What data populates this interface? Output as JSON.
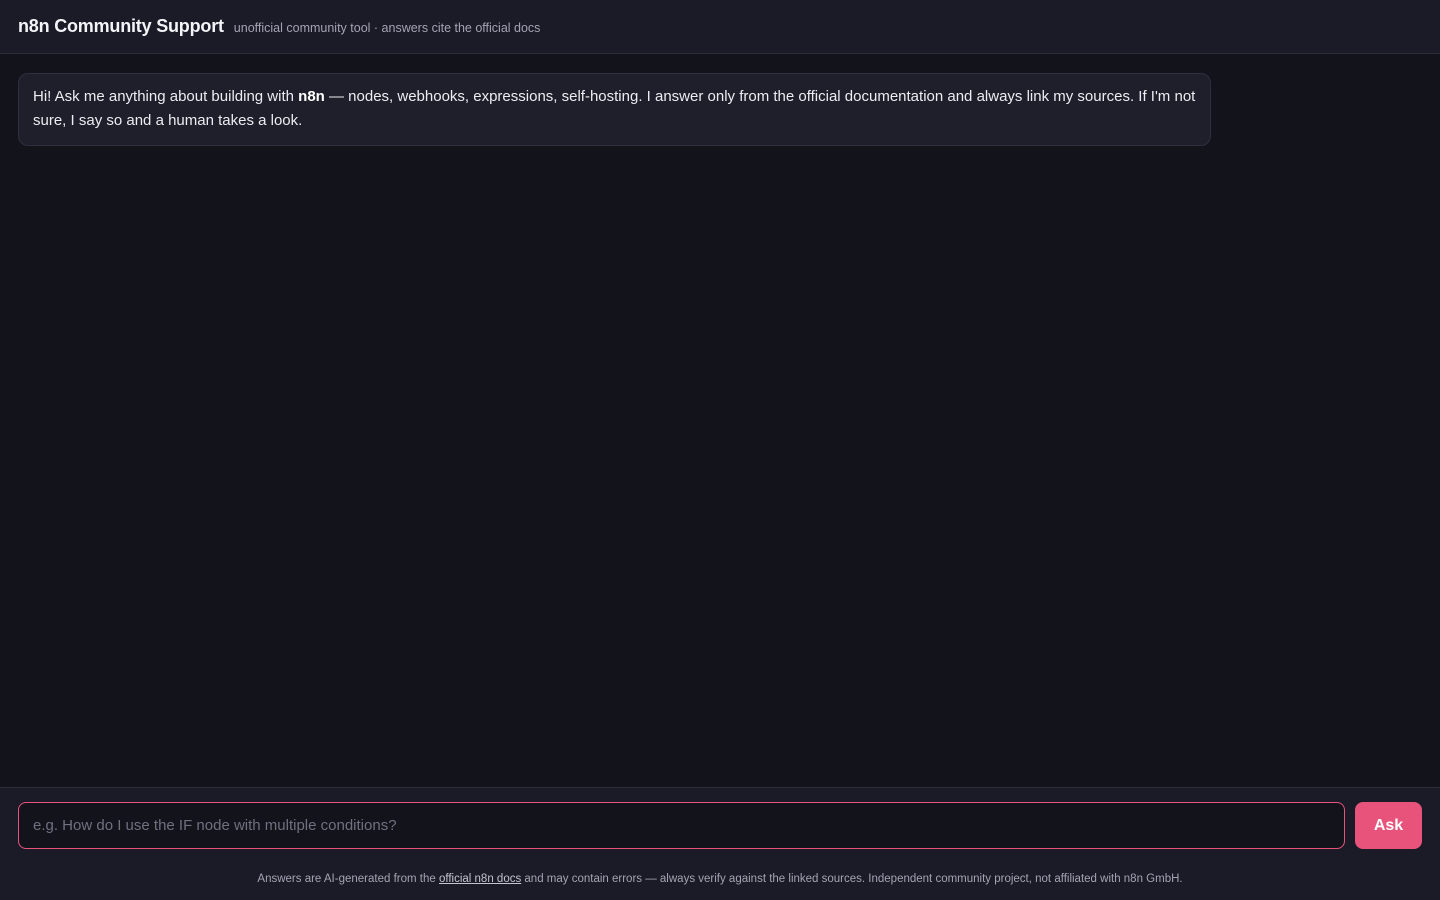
{
  "header": {
    "title": "n8n Community Support",
    "subtitle": "unofficial community tool · answers cite the official docs"
  },
  "messages": [
    {
      "role": "assistant",
      "text_before": "Hi! Ask me anything about building with ",
      "text_bold": "n8n",
      "text_after": " — nodes, webhooks, expressions, self-hosting. I answer only from the official documentation and always link my sources. If I'm not sure, I say so and a human takes a look."
    }
  ],
  "composer": {
    "placeholder": "e.g. How do I use the IF node with multiple conditions?",
    "value": "",
    "submit_label": "Ask"
  },
  "footer": {
    "text_before": "Answers are AI-generated from the ",
    "link_label": "official n8n docs",
    "text_after": " and may contain errors — always verify against the linked sources. Independent community project, not affiliated with n8n GmbH."
  },
  "colors": {
    "accent": "#e8537b",
    "background": "#13131c",
    "surface": "#1b1b27",
    "bubble": "#1f1f2c"
  }
}
